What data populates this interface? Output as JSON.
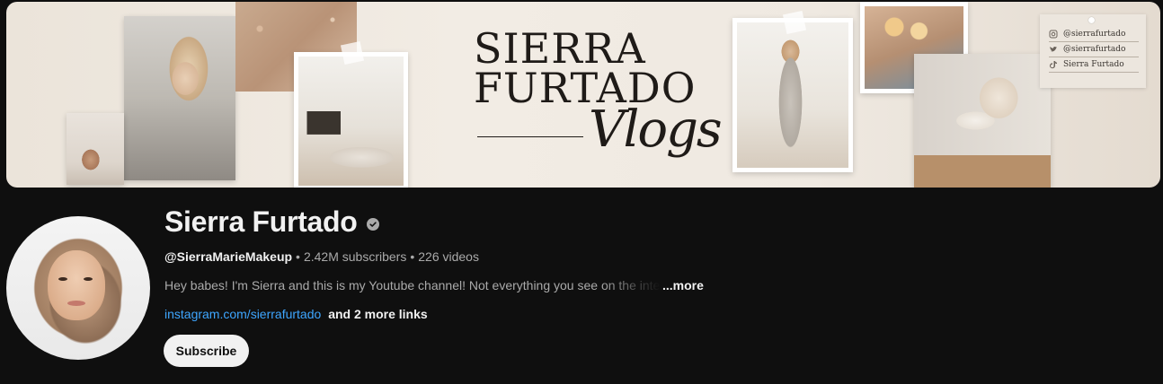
{
  "banner": {
    "brand_line1": "SIERRA",
    "brand_line2": "FURTADO",
    "brand_script": "Vlogs",
    "socials": [
      {
        "icon": "instagram-icon",
        "label": "@sierrafurtado"
      },
      {
        "icon": "twitter-icon",
        "label": "@sierrafurtado"
      },
      {
        "icon": "tiktok-icon",
        "label": "Sierra Furtado"
      }
    ]
  },
  "channel": {
    "name": "Sierra Furtado",
    "verified": true,
    "handle": "@SierraMarieMakeup",
    "subscribers": "2.42M subscribers",
    "videos": "226 videos",
    "description": "Hey babes! I'm Sierra and this is my Youtube channel! Not everything you see on the internet",
    "more_label": "...more",
    "link": "instagram.com/sierrafurtado",
    "more_links": "and 2 more links",
    "subscribe_label": "Subscribe"
  },
  "colors": {
    "background": "#0f0f0f",
    "text_primary": "#f1f1f1",
    "text_secondary": "#aaaaaa",
    "link": "#3ea6ff",
    "subscribe_bg": "#f1f1f1"
  }
}
